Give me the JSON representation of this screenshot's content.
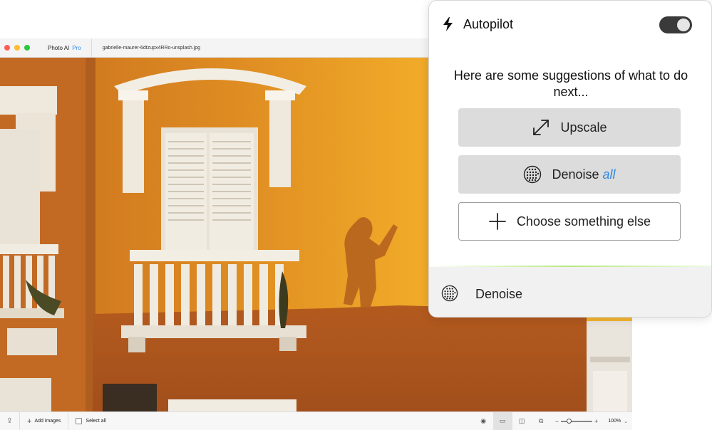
{
  "window": {
    "app_name": "Photo AI",
    "app_tier": "Pro",
    "file_name": "gabrielle-maurer-6dtzupx4RRo-unsplash.jpg"
  },
  "bottom_toolbar": {
    "add_images": "Add images",
    "select_all": "Select all",
    "zoom_level": "100%",
    "zoom_slider_fraction": 0.25
  },
  "autopilot": {
    "title": "Autopilot",
    "enabled": true,
    "suggestions_heading": "Here are some suggestions of what to do next...",
    "suggestions": [
      {
        "label": "Upscale",
        "icon": "expand-arrows-icon"
      },
      {
        "label": "Denoise",
        "modifier": "all",
        "icon": "dot-grid-icon"
      }
    ],
    "choose_other": "Choose something else",
    "active_item": {
      "label": "Denoise",
      "icon": "dot-grid-icon"
    },
    "accent_color": "#2f8ae5"
  }
}
